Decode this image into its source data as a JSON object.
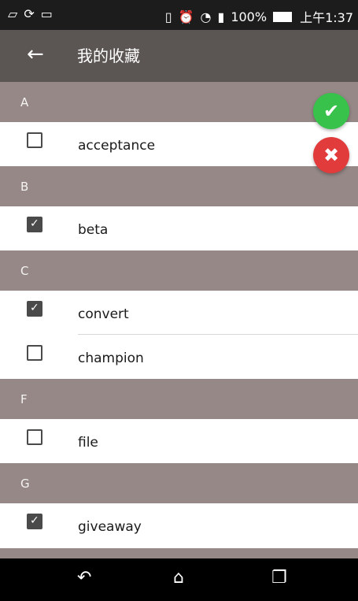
{
  "status_bar": {
    "left_icons": [
      "image-icon",
      "sync-icon",
      "photo-icon"
    ],
    "right_icons": [
      "vibrate-icon",
      "alarm-icon",
      "wifi-icon",
      "signal-icon"
    ],
    "battery": "100%",
    "time": "上午1:37"
  },
  "app_bar": {
    "title": "我的收藏"
  },
  "sections": [
    {
      "letter": "A",
      "items": [
        {
          "label": "acceptance",
          "checked": false
        }
      ]
    },
    {
      "letter": "B",
      "items": [
        {
          "label": "beta",
          "checked": true
        }
      ]
    },
    {
      "letter": "C",
      "items": [
        {
          "label": "convert",
          "checked": true
        },
        {
          "label": "champion",
          "checked": false
        }
      ]
    },
    {
      "letter": "F",
      "items": [
        {
          "label": "file",
          "checked": false
        }
      ]
    },
    {
      "letter": "G",
      "items": [
        {
          "label": "giveaway",
          "checked": true
        }
      ]
    }
  ],
  "fab": {
    "confirm_icon": "check-icon",
    "cancel_icon": "close-icon"
  },
  "colors": {
    "header_bg": "#958886",
    "app_bar_bg": "#5b5654",
    "confirm": "#38c24c",
    "cancel": "#e23b3b"
  },
  "nav_bar": {
    "icons": [
      "back-icon",
      "home-icon",
      "recents-icon"
    ]
  }
}
